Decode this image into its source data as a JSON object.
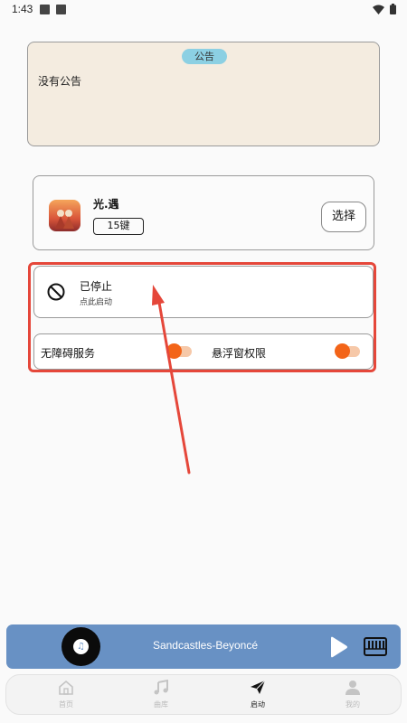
{
  "status_bar": {
    "time": "1:43"
  },
  "notice": {
    "badge": "公告",
    "text": "没有公告"
  },
  "game": {
    "name": "光.遇",
    "key_badge": "15键",
    "select_label": "选择"
  },
  "service": {
    "status_title": "已停止",
    "status_subtitle": "点此启动"
  },
  "permissions": {
    "accessibility_label": "无障碍服务",
    "overlay_label": "悬浮窗权限"
  },
  "player": {
    "song": "Sandcastles-Beyoncé"
  },
  "nav": {
    "items": [
      {
        "label": "首页",
        "icon": "home-icon"
      },
      {
        "label": "曲库",
        "icon": "music-note-icon"
      },
      {
        "label": "启动",
        "icon": "paper-plane-icon"
      },
      {
        "label": "我的",
        "icon": "person-icon"
      }
    ],
    "active": "启动"
  },
  "colors": {
    "accent_orange": "#f36418",
    "highlight_red": "#e5473a",
    "player_blue": "#6891c4",
    "notice_bg": "#f4ece0",
    "badge_blue": "#8cd0e3"
  }
}
